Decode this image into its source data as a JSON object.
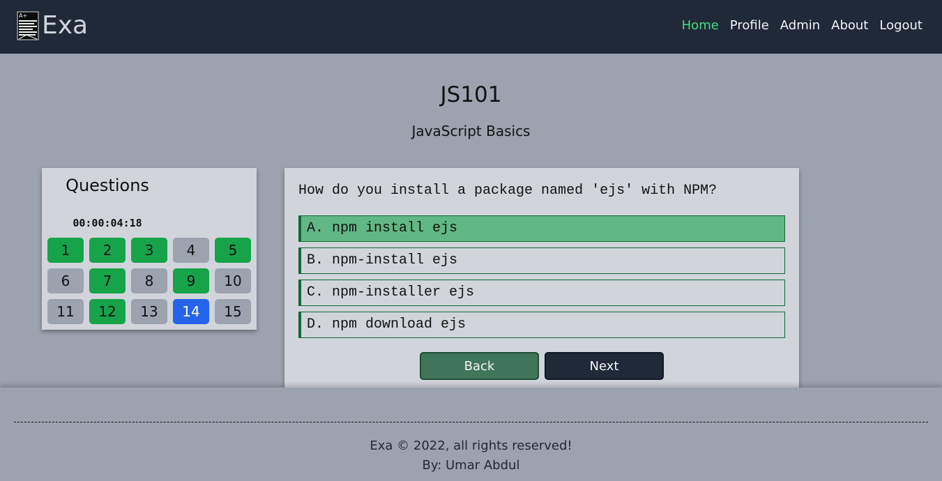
{
  "header": {
    "brand_name": "Exa",
    "logo_icon": "exam-paper-icon",
    "logo_badge": "A+",
    "nav": [
      {
        "label": "Home",
        "active": true
      },
      {
        "label": "Profile",
        "active": false
      },
      {
        "label": "Admin",
        "active": false
      },
      {
        "label": "About",
        "active": false
      },
      {
        "label": "Logout",
        "active": false
      }
    ],
    "active_color": "#4ade80"
  },
  "course": {
    "code": "JS101",
    "name": "JavaScript Basics"
  },
  "questions_panel": {
    "title": "Questions",
    "timer": "00:00:04:18",
    "items": [
      {
        "label": "1",
        "status": "answered"
      },
      {
        "label": "2",
        "status": "answered"
      },
      {
        "label": "3",
        "status": "answered"
      },
      {
        "label": "4",
        "status": "unanswered"
      },
      {
        "label": "5",
        "status": "answered"
      },
      {
        "label": "6",
        "status": "unanswered"
      },
      {
        "label": "7",
        "status": "answered"
      },
      {
        "label": "8",
        "status": "unanswered"
      },
      {
        "label": "9",
        "status": "answered"
      },
      {
        "label": "10",
        "status": "unanswered"
      },
      {
        "label": "11",
        "status": "unanswered"
      },
      {
        "label": "12",
        "status": "answered"
      },
      {
        "label": "13",
        "status": "unanswered"
      },
      {
        "label": "14",
        "status": "current"
      },
      {
        "label": "15",
        "status": "unanswered"
      }
    ],
    "colors": {
      "answered": "#16a34a",
      "current": "#2563eb",
      "unanswered": "#9ca3af"
    }
  },
  "question": {
    "text": "How do you install a package named 'ejs' with NPM?",
    "options": [
      {
        "label": "A. npm install ejs",
        "selected": true
      },
      {
        "label": "B. npm-install ejs",
        "selected": false
      },
      {
        "label": "C. npm-installer ejs",
        "selected": false
      },
      {
        "label": "D. npm download ejs",
        "selected": false
      }
    ],
    "back_label": "Back",
    "next_label": "Next"
  },
  "footer": {
    "copyright": "Exa © 2022, all rights reserved!",
    "author": "By: Umar Abdul"
  }
}
